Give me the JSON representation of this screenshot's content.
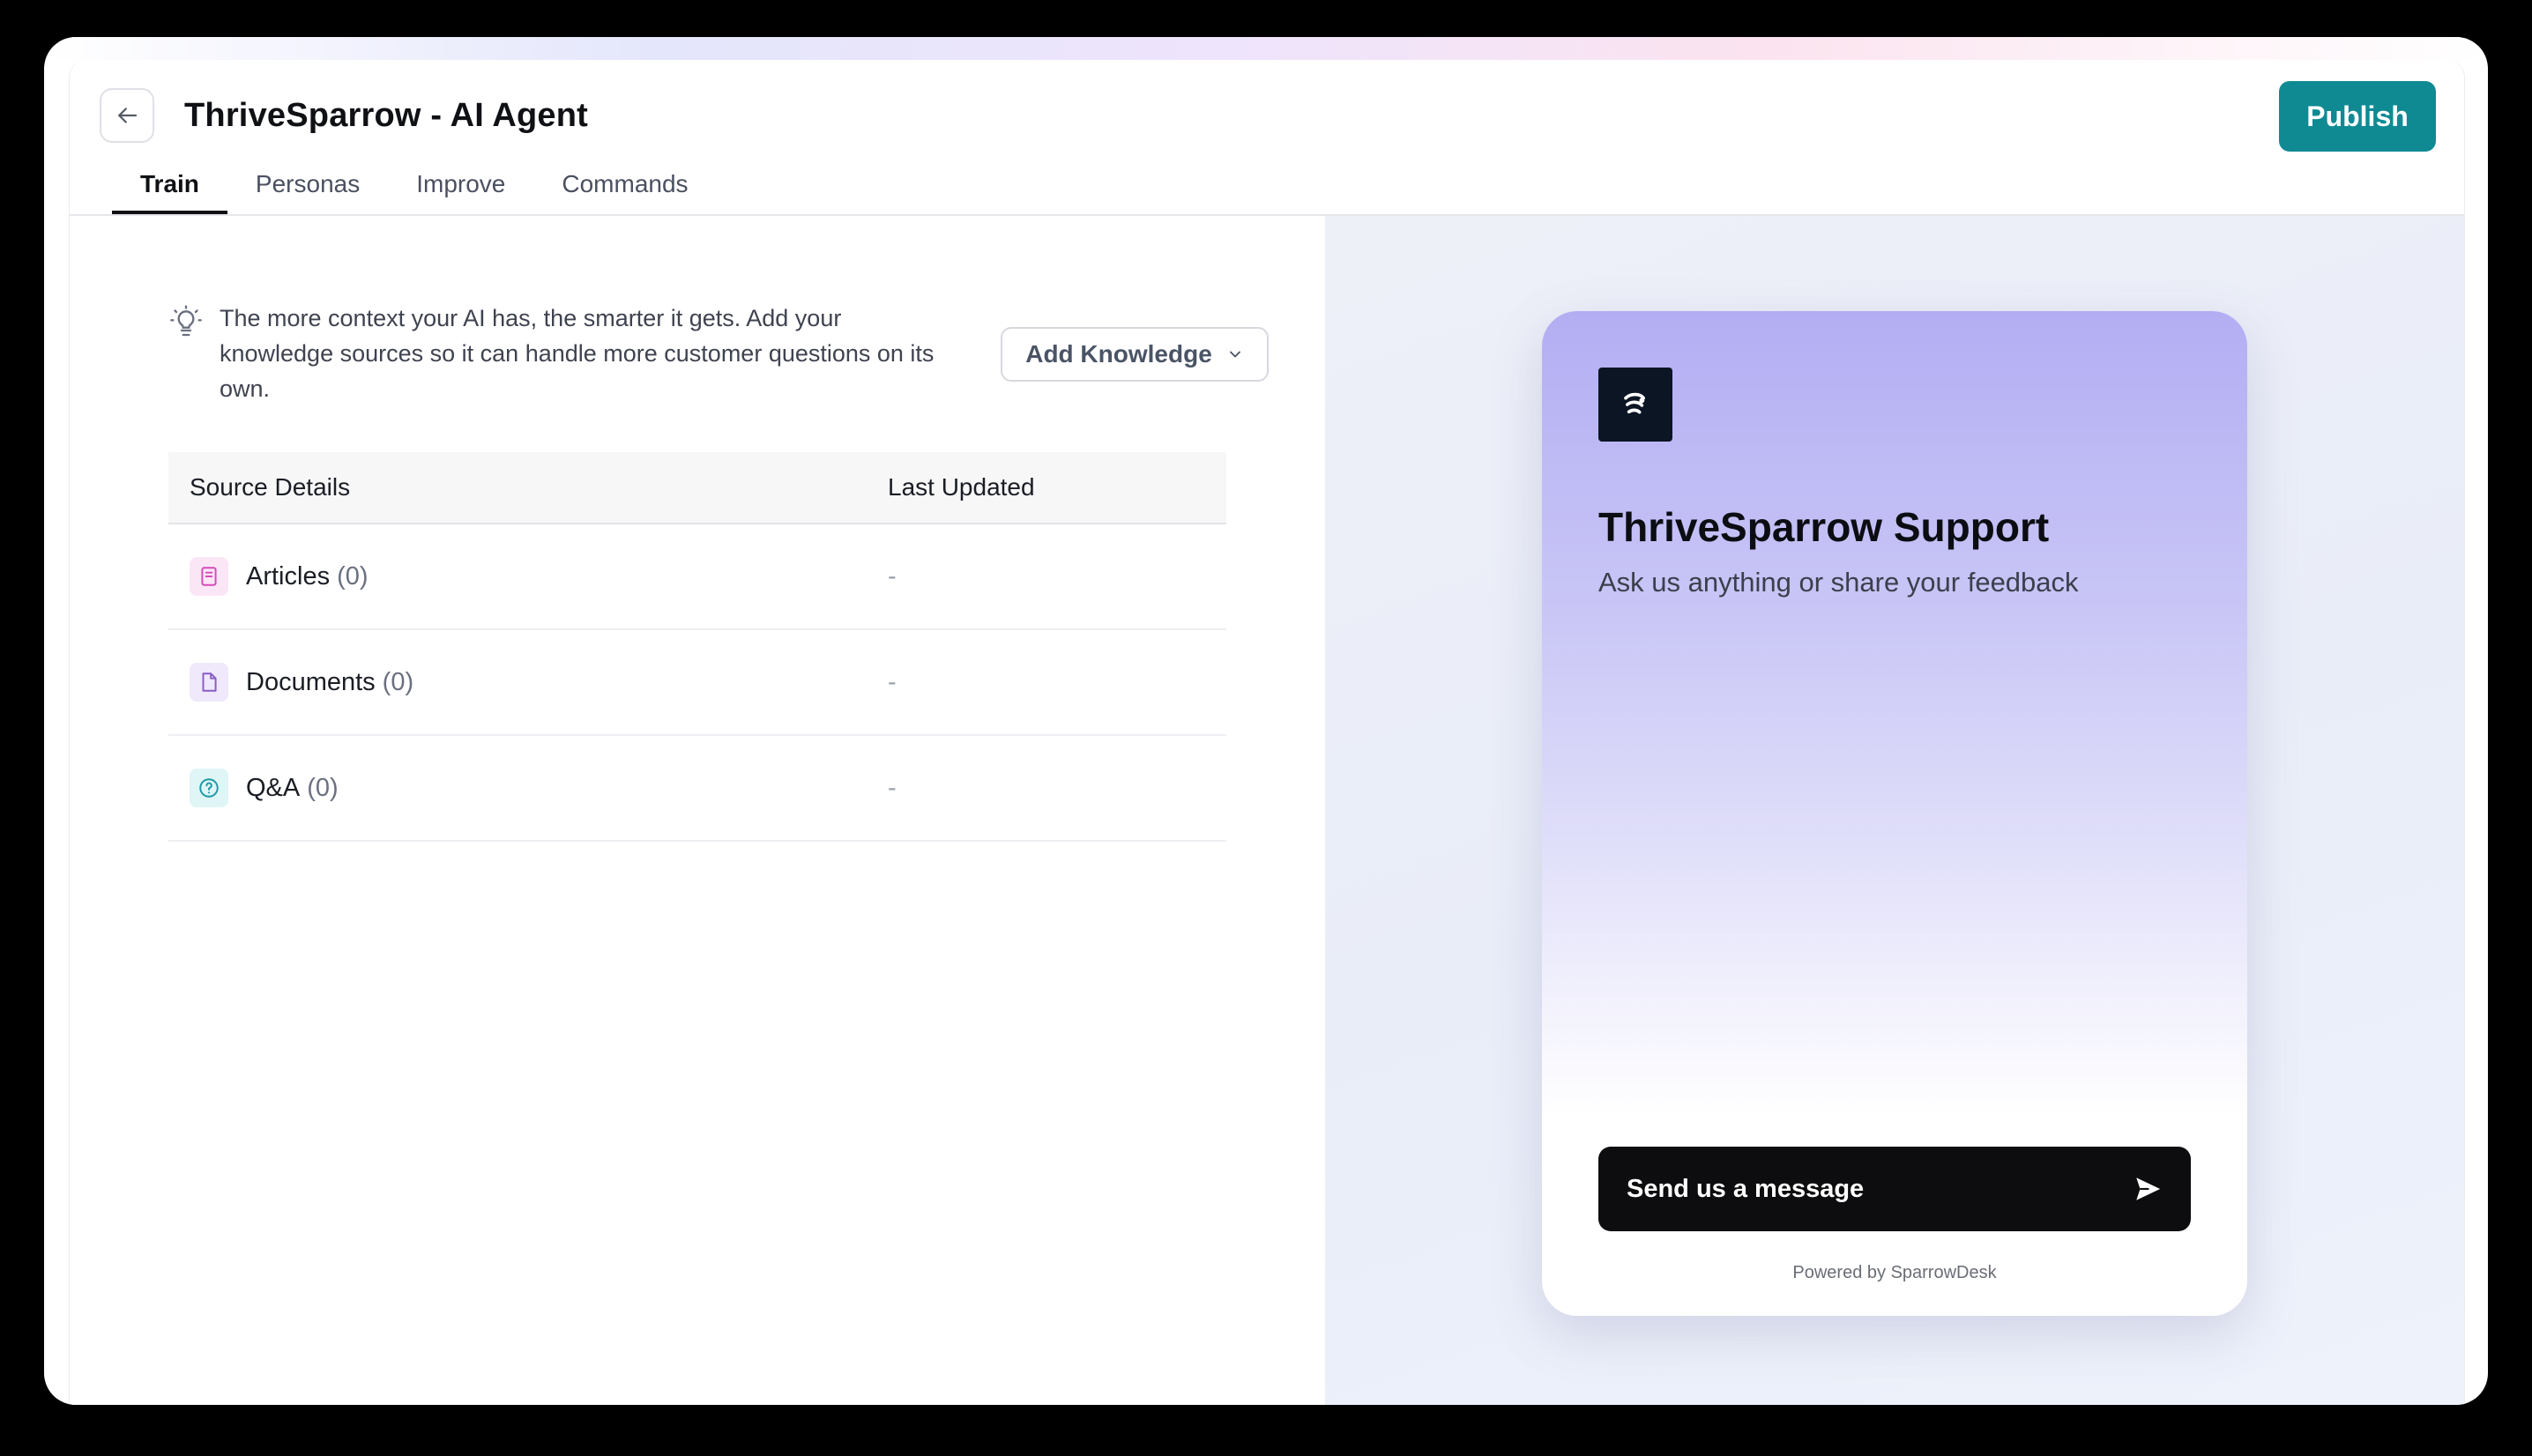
{
  "header": {
    "title": "ThriveSparrow - AI Agent",
    "publish_label": "Publish"
  },
  "tabs": [
    {
      "label": "Train",
      "active": true
    },
    {
      "label": "Personas",
      "active": false
    },
    {
      "label": "Improve",
      "active": false
    },
    {
      "label": "Commands",
      "active": false
    }
  ],
  "train": {
    "hint": "The more context your AI has, the smarter it gets. Add your knowledge sources so it can handle more customer questions on its own.",
    "add_knowledge_label": "Add Knowledge",
    "table": {
      "headers": {
        "source": "Source Details",
        "updated": "Last Updated"
      },
      "rows": [
        {
          "name": "Articles",
          "count": "(0)",
          "updated": "-",
          "icon": "article-icon",
          "icon_color": "#d64ab8",
          "icon_bg": "#fbe6f6"
        },
        {
          "name": "Documents",
          "count": "(0)",
          "updated": "-",
          "icon": "document-icon",
          "icon_color": "#8a5cc7",
          "icon_bg": "#f0e8fb"
        },
        {
          "name": "Q&A",
          "count": "(0)",
          "updated": "-",
          "icon": "question-circle-icon",
          "icon_color": "#1a9aa6",
          "icon_bg": "#e0f5f6"
        }
      ]
    }
  },
  "preview": {
    "title": "ThriveSparrow Support",
    "subtitle": "Ask us anything or share your feedback",
    "send_label": "Send us a message",
    "powered_by": "Powered by SparrowDesk"
  },
  "colors": {
    "accent": "#0f8a93",
    "widget_gradient_top": "#b3aef3"
  }
}
